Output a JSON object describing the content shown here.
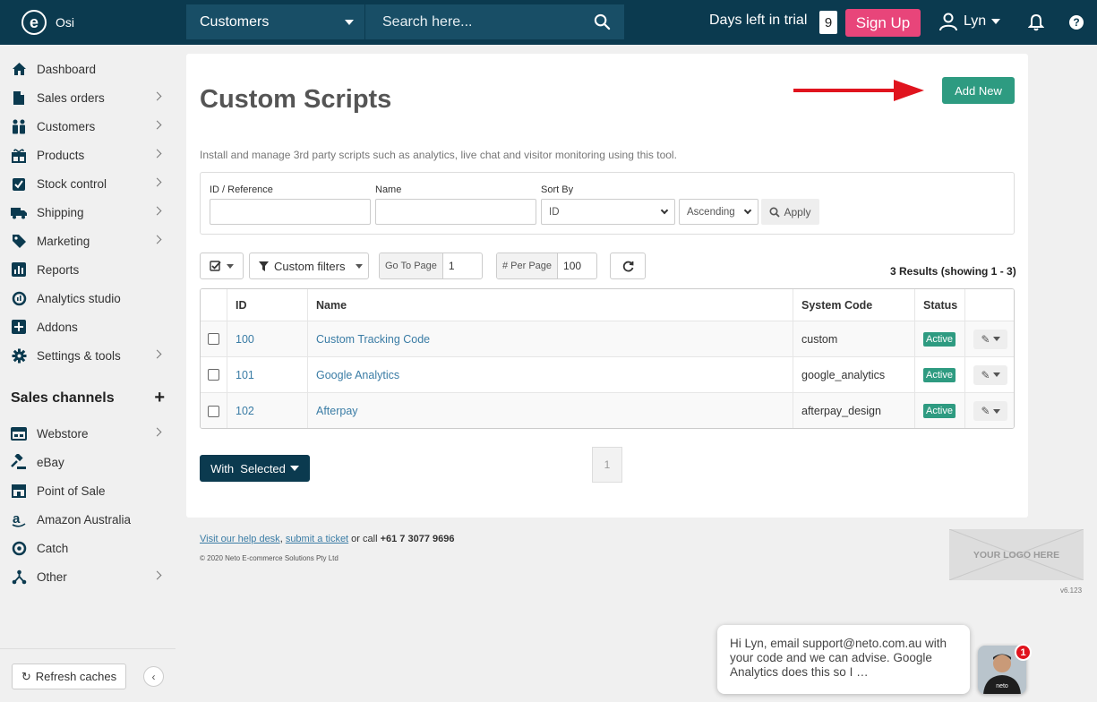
{
  "header": {
    "brand_logo": "e",
    "brand_name": "Osi",
    "search_scope": "Customers",
    "search_placeholder": "Search here...",
    "trial_label": "Days left in trial",
    "trial_days": "9",
    "signup_label": "Sign Up",
    "user_name": "Lyn",
    "help_label": "?"
  },
  "sidebar": {
    "items": [
      {
        "label": "Dashboard",
        "icon": "home-icon"
      },
      {
        "label": "Sales orders",
        "icon": "document-icon"
      },
      {
        "label": "Customers",
        "icon": "users-icon"
      },
      {
        "label": "Products",
        "icon": "gift-icon"
      },
      {
        "label": "Stock control",
        "icon": "checklist-icon"
      },
      {
        "label": "Shipping",
        "icon": "truck-icon"
      },
      {
        "label": "Marketing",
        "icon": "tag-icon"
      },
      {
        "label": "Reports",
        "icon": "bar-chart-icon"
      },
      {
        "label": "Analytics studio",
        "icon": "analytics-icon"
      },
      {
        "label": "Addons",
        "icon": "plus-square-icon"
      },
      {
        "label": "Settings & tools",
        "icon": "gear-icon"
      }
    ],
    "channels_title": "Sales channels",
    "channels_plus": "+",
    "channels": [
      {
        "label": "Webstore",
        "icon": "webstore-icon"
      },
      {
        "label": "eBay",
        "icon": "gavel-icon"
      },
      {
        "label": "Point of Sale",
        "icon": "store-icon"
      },
      {
        "label": "Amazon Australia",
        "icon": "amazon-icon"
      },
      {
        "label": "Catch",
        "icon": "catch-icon"
      },
      {
        "label": "Other",
        "icon": "share-icon"
      }
    ],
    "refresh_label": "Refresh caches",
    "collapse_label": "‹"
  },
  "page": {
    "title": "Custom Scripts",
    "add_new_label": "Add New",
    "description": "Install and manage 3rd party scripts such as analytics, live chat and visitor monitoring using this tool."
  },
  "filters": {
    "id_label": "ID / Reference",
    "name_label": "Name",
    "sort_label": "Sort By",
    "sort_value": "ID",
    "order_value": "Ascending",
    "apply_label": "Apply"
  },
  "toolbar": {
    "custom_filters_label": "Custom filters",
    "goto_label": "Go To Page",
    "goto_value": "1",
    "per_page_label": "# Per Page",
    "per_page_value": "100",
    "results_text": "3 Results (showing 1 - 3)"
  },
  "table": {
    "headers": {
      "id": "ID",
      "name": "Name",
      "system_code": "System Code",
      "status": "Status"
    },
    "rows": [
      {
        "id": "100",
        "name": "Custom Tracking Code",
        "system_code": "custom",
        "status": "Active"
      },
      {
        "id": "101",
        "name": "Google Analytics",
        "system_code": "google_analytics",
        "status": "Active"
      },
      {
        "id": "102",
        "name": "Afterpay",
        "system_code": "afterpay_design",
        "status": "Active"
      }
    ]
  },
  "bulk": {
    "with_selected_label": "With  Selected"
  },
  "pagination": {
    "current_page": "1"
  },
  "footer": {
    "help_desk_link": "Visit our help desk",
    "comma": ",",
    "submit_ticket_link": "submit a ticket",
    "or_call": " or call ",
    "phone": "+61 7 3077 9696",
    "copyright": "© 2020 Neto E-commerce Solutions Pty Ltd",
    "logo_placeholder": "YOUR LOGO HERE",
    "version": "v6.123"
  },
  "chat": {
    "message": "Hi Lyn, email support@neto.com.au with your code and we can advise. Google Analytics does this so I …",
    "unread_count": "1",
    "avatar_shirt_text": "neto"
  },
  "colors": {
    "topbar": "#0b3a4f",
    "signup": "#e8457a",
    "primary": "#2e9b81",
    "link": "#3a7ca5",
    "arrow": "#e0141e"
  }
}
